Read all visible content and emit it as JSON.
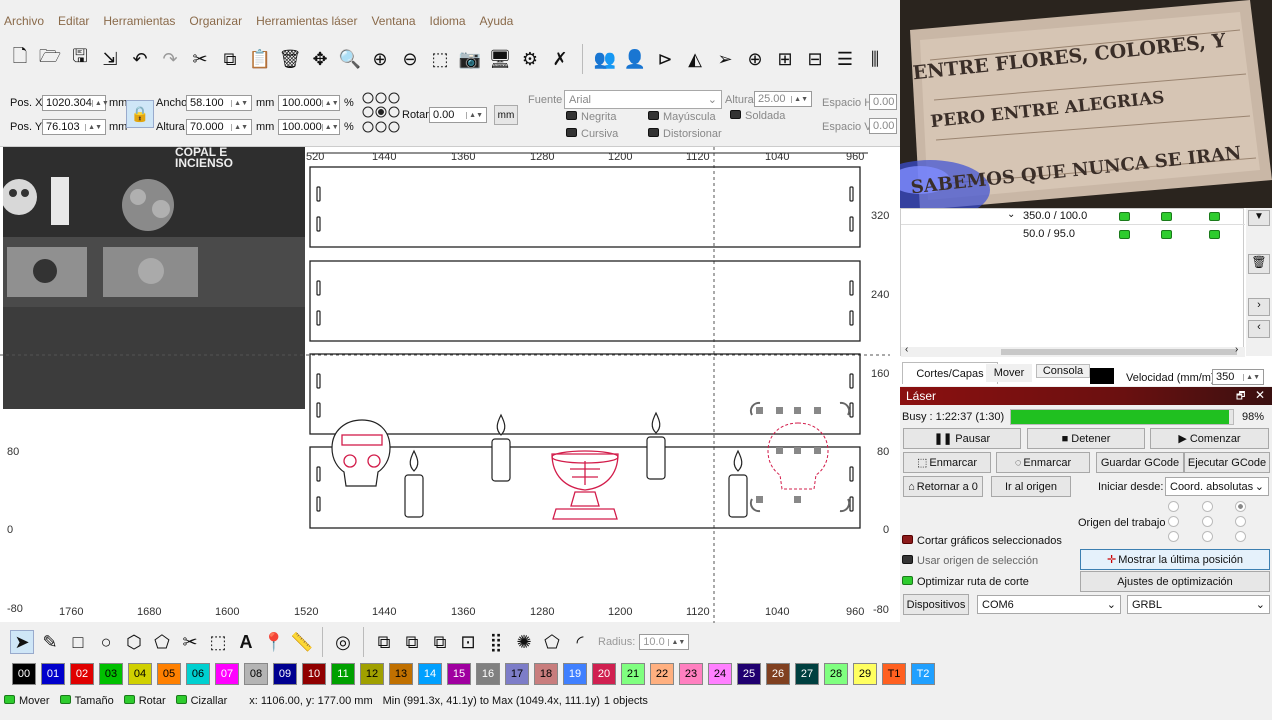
{
  "menu": [
    "Archivo",
    "Editar",
    "Herramientas",
    "Organizar",
    "Herramientas láser",
    "Ventana",
    "Idioma",
    "Ayuda"
  ],
  "props": {
    "pos_x_label": "Pos. X",
    "pos_x": "1020.304",
    "pos_y_label": "Pos. Y",
    "pos_y": "76.103",
    "unit": "mm",
    "ancho_label": "Ancho",
    "ancho": "58.100",
    "altura_label": "Altura",
    "altura": "70.000",
    "scale_w": "100.000",
    "scale_h": "100.000",
    "pct": "%",
    "rotar_label": "Rotar",
    "rotar": "0.00",
    "mm_button": "mm",
    "fuente_label": "Fuente",
    "fuente": "Arial",
    "font_altura_label": "Altura",
    "font_altura": "25.00",
    "espacio_h_label": "Espacio H",
    "espacio_h": "0.00",
    "espacio_v_label": "Espacio V",
    "espacio_v": "0.00",
    "negrita": "Negrita",
    "mayuscula": "Mayúscula",
    "soldada": "Soldada",
    "cursiva": "Cursiva",
    "distorsionar": "Distorsionar"
  },
  "ruler": {
    "top": [
      "520",
      "1440",
      "1360",
      "1280",
      "1200",
      "1120",
      "1040",
      "960"
    ],
    "bottom": [
      "1760",
      "1680",
      "1600",
      "1520",
      "1440",
      "1360",
      "1280",
      "1200",
      "1120",
      "1040",
      "960"
    ],
    "right": [
      "320",
      "240",
      "160",
      "80",
      "0",
      "-80"
    ],
    "left": [
      "80",
      "0",
      "-80"
    ]
  },
  "photo_text": [
    "COPAL E",
    "INCIENSO"
  ],
  "webcam_text": [
    "ENTRE FLORES, COLORES, Y",
    "PERO ENTRE ALEGRIAS",
    "SABEMOS QUE NUNCA SE IRAN"
  ],
  "cuts": {
    "rows": [
      {
        "value": "350.0 / 100.0"
      },
      {
        "value": "50.0 / 95.0"
      }
    ],
    "tabs": [
      "Cortes/Capas",
      "Mover",
      "Consola"
    ],
    "velocidad_label": "Velocidad (mm/m)",
    "velocidad": "350"
  },
  "laser": {
    "title": "Láser",
    "busy": "Busy : 1:22:37 (1:30)",
    "progress": 0.98,
    "progress_text": "98%",
    "pausar": "Pausar",
    "detener": "Detener",
    "comenzar": "Comenzar",
    "enmarcar1": "Enmarcar",
    "enmarcar2": "Enmarcar",
    "guardar": "Guardar GCode",
    "ejecutar": "Ejecutar GCode",
    "retornar": "Retornar a 0",
    "ir_origen": "Ir al origen",
    "iniciar_label": "Iniciar desde:",
    "iniciar": "Coord. absolutas",
    "origen_label": "Origen del trabajo",
    "cortar_sel": "Cortar gráficos seleccionados",
    "usar_origen": "Usar origen de selección",
    "mostrar": "Mostrar la última posición",
    "optimizar": "Optimizar ruta de corte",
    "ajustes": "Ajustes de optimización",
    "dispositivos": "Dispositivos",
    "com": "COM6",
    "grbl": "GRBL"
  },
  "radius_label": "Radius:",
  "radius": "10.0",
  "palette": [
    {
      "label": "00",
      "color": "#000000",
      "text": "#ffffff"
    },
    {
      "label": "01",
      "color": "#0000cc",
      "text": "#ffffff"
    },
    {
      "label": "02",
      "color": "#e00000",
      "text": "#ffffff"
    },
    {
      "label": "03",
      "color": "#00c000",
      "text": "#000000"
    },
    {
      "label": "04",
      "color": "#d0d000",
      "text": "#000000"
    },
    {
      "label": "05",
      "color": "#ff8000",
      "text": "#000000"
    },
    {
      "label": "06",
      "color": "#00d0d0",
      "text": "#000000"
    },
    {
      "label": "07",
      "color": "#ff00ff",
      "text": "#ffffff"
    },
    {
      "label": "08",
      "color": "#b4b4b4",
      "text": "#000000"
    },
    {
      "label": "09",
      "color": "#000090",
      "text": "#ffffff"
    },
    {
      "label": "10",
      "color": "#900000",
      "text": "#ffffff"
    },
    {
      "label": "11",
      "color": "#00a000",
      "text": "#ffffff"
    },
    {
      "label": "12",
      "color": "#a0a000",
      "text": "#000000"
    },
    {
      "label": "13",
      "color": "#c07000",
      "text": "#000000"
    },
    {
      "label": "14",
      "color": "#00a0ff",
      "text": "#ffffff"
    },
    {
      "label": "15",
      "color": "#a000a0",
      "text": "#ffffff"
    },
    {
      "label": "16",
      "color": "#808080",
      "text": "#ffffff"
    },
    {
      "label": "17",
      "color": "#7d7dc8",
      "text": "#000000"
    },
    {
      "label": "18",
      "color": "#c87d7d",
      "text": "#000000"
    },
    {
      "label": "19",
      "color": "#4080ff",
      "text": "#ffffff"
    },
    {
      "label": "20",
      "color": "#d02050",
      "text": "#ffffff"
    },
    {
      "label": "21",
      "color": "#80ff80",
      "text": "#000000"
    },
    {
      "label": "22",
      "color": "#ffb080",
      "text": "#000000"
    },
    {
      "label": "23",
      "color": "#ff80c0",
      "text": "#000000"
    },
    {
      "label": "24",
      "color": "#ff80ff",
      "text": "#000000"
    },
    {
      "label": "25",
      "color": "#200070",
      "text": "#ffffff"
    },
    {
      "label": "26",
      "color": "#804020",
      "text": "#ffffff"
    },
    {
      "label": "27",
      "color": "#004040",
      "text": "#ffffff"
    },
    {
      "label": "28",
      "color": "#80ff80",
      "text": "#000000"
    },
    {
      "label": "29",
      "color": "#ffff60",
      "text": "#000000"
    },
    {
      "label": "T1",
      "color": "#ff6020",
      "text": "#000000"
    },
    {
      "label": "T2",
      "color": "#20a0ff",
      "text": "#ffffff"
    }
  ],
  "status": {
    "mover": "Mover",
    "tamano": "Tamaño",
    "rotar": "Rotar",
    "cizallar": "Cizallar",
    "coords": "x: 1106.00, y: 177.00 mm",
    "minmax": "Min (991.3x, 41.1y) to Max (1049.4x, 111.1y)",
    "objects": "1 objects"
  },
  "accent_progress": "#20c020"
}
